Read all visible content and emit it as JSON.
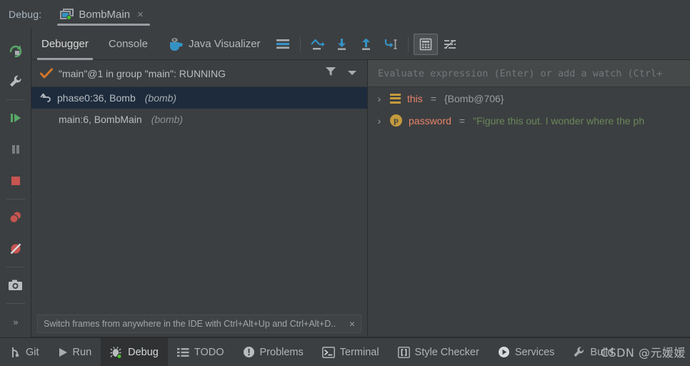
{
  "window": {
    "debug_label": "Debug:",
    "run_tab": {
      "title": "BombMain",
      "icon": "run-config-icon",
      "close": "×"
    }
  },
  "left_toolbar": {
    "items": [
      {
        "name": "rerun-button",
        "icon": "rerun-icon",
        "tooltip": "Rerun"
      },
      {
        "name": "edit-configuration-button",
        "icon": "wrench-icon",
        "tooltip": "Edit Configuration"
      },
      {
        "name": "resume-program-button",
        "icon": "resume-icon",
        "tooltip": "Resume Program"
      },
      {
        "name": "pause-program-button",
        "icon": "pause-icon",
        "tooltip": "Pause Program"
      },
      {
        "name": "stop-button",
        "icon": "stop-icon",
        "tooltip": "Stop"
      },
      {
        "name": "view-breakpoints-button",
        "icon": "breakpoints-icon",
        "tooltip": "View Breakpoints"
      },
      {
        "name": "mute-breakpoints-button",
        "icon": "mute-breakpoints-icon",
        "tooltip": "Mute Breakpoints"
      },
      {
        "name": "screenshot-button",
        "icon": "camera-icon",
        "tooltip": "Screenshot"
      },
      {
        "name": "more-options-button",
        "icon": "chevron-double-right-icon",
        "label": "»"
      }
    ]
  },
  "debug_tabs": {
    "tabs": [
      {
        "label": "Debugger",
        "active": true
      },
      {
        "label": "Console",
        "active": false
      },
      {
        "label": "Java Visualizer",
        "active": false,
        "icon": "java-coffee-icon"
      }
    ],
    "toolbar": [
      {
        "name": "layout-settings-icon",
        "icon": "lines-icon"
      },
      {
        "name": "step-over-icon",
        "icon": "step-over-icon"
      },
      {
        "name": "step-into-icon",
        "icon": "step-into-icon"
      },
      {
        "name": "step-out-icon",
        "icon": "step-out-icon"
      },
      {
        "name": "force-step-into-icon",
        "icon": "force-step-into-icon"
      },
      {
        "name": "evaluate-expression-icon",
        "icon": "calculator-icon"
      },
      {
        "name": "settings-icon",
        "icon": "sliders-icon"
      }
    ]
  },
  "frames_pane": {
    "thread": "\"main\"@1 in group \"main\": RUNNING",
    "thread_state_icon": "checkmark-icon",
    "filter_icon": "funnel-icon",
    "dropdown_icon": "chevron-down-icon",
    "frames": [
      {
        "location": "phase0:36, Bomb",
        "module": "(bomb)",
        "selected": true,
        "icon": "back-arrow-icon"
      },
      {
        "location": "main:6, BombMain",
        "module": "(bomb)",
        "selected": false
      }
    ],
    "hint": "Switch frames from anywhere in the IDE with Ctrl+Alt+Up and Ctrl+Alt+D..",
    "hint_close": "×"
  },
  "variables_pane": {
    "evaluate_placeholder": "Evaluate expression (Enter) or add a watch (Ctrl+",
    "variables": [
      {
        "chevron": "›",
        "icon": "field-icon",
        "name": "this",
        "equals": "=",
        "value": "{Bomb@706}",
        "value_kind": "object"
      },
      {
        "chevron": "›",
        "icon": "parameter-icon",
        "icon_letter": "p",
        "name": "password",
        "equals": "=",
        "value": "\"Figure this out. I wonder where the ph",
        "value_kind": "string"
      }
    ]
  },
  "status_bar": {
    "items": [
      {
        "label": "Git",
        "icon": "git-branch-icon",
        "active": false
      },
      {
        "label": "Run",
        "icon": "play-icon",
        "active": false
      },
      {
        "label": "Debug",
        "icon": "bug-icon",
        "active": true
      },
      {
        "label": "TODO",
        "icon": "todo-list-icon",
        "active": false
      },
      {
        "label": "Problems",
        "icon": "problems-icon",
        "active": false
      },
      {
        "label": "Terminal",
        "icon": "terminal-icon",
        "active": false
      },
      {
        "label": "Style Checker",
        "icon": "brackets-icon",
        "active": false
      },
      {
        "label": "Services",
        "icon": "services-play-icon",
        "active": false
      },
      {
        "label": "Build",
        "icon": "build-icon",
        "active": false
      }
    ]
  },
  "watermark": {
    "text": "CSDN @元媛媛"
  },
  "colors": {
    "background": "#3c3f41",
    "selected_row": "#1d2b3d",
    "accent_blue": "#3592c4",
    "variable_name": "#e8836a",
    "string_value": "#6a8759",
    "gold": "#c49a3e",
    "green": "#48c12a",
    "red": "#c75450"
  }
}
